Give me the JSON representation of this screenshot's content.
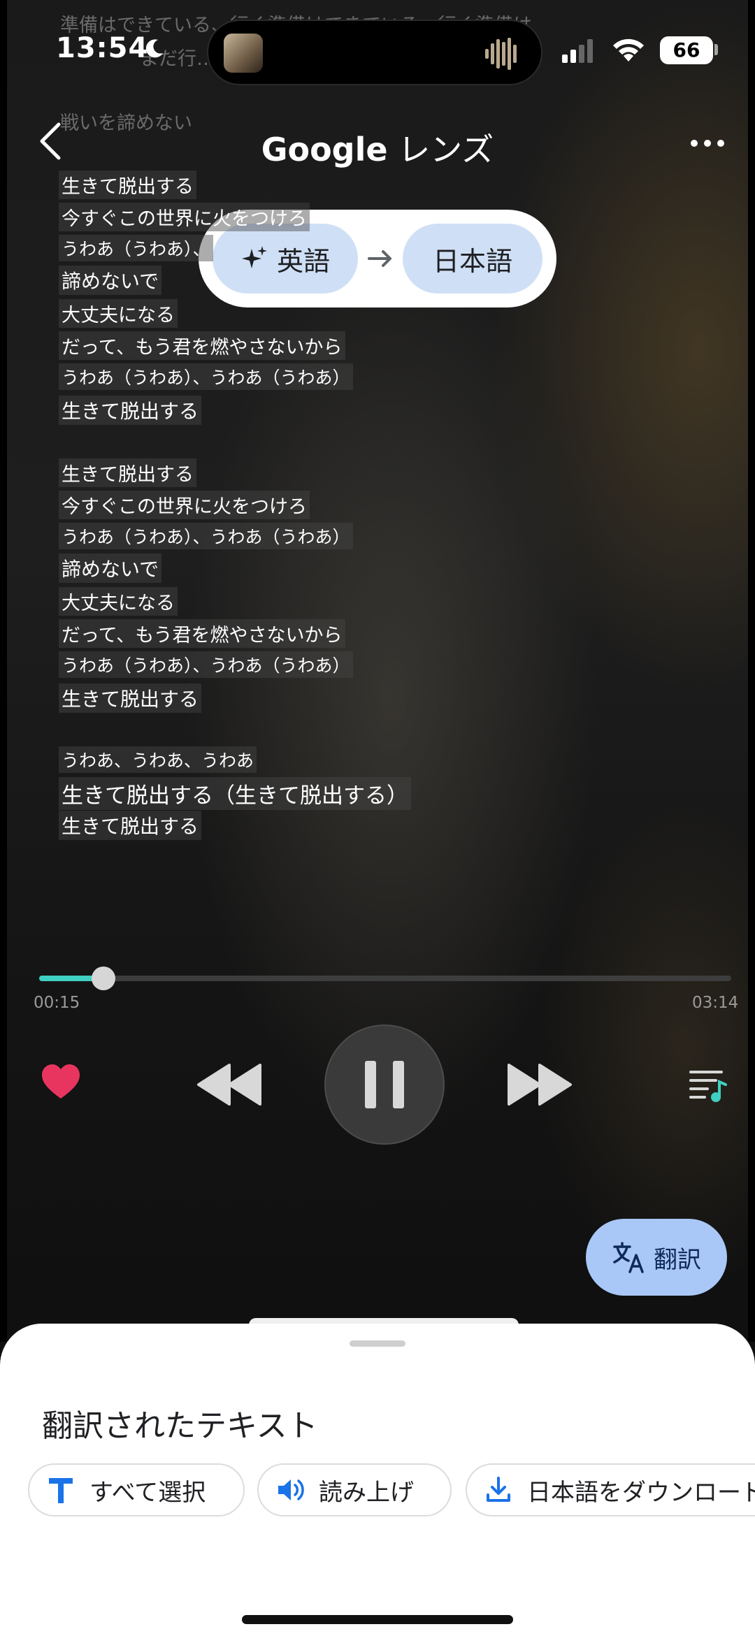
{
  "status_bar": {
    "time": "13:54",
    "battery": "66"
  },
  "faded_lyrics": [
    "準備はできている、行く準備はできている、行く準備は",
    "まだ行…",
    "戦いを諦めない"
  ],
  "header": {
    "title_brand": "Google",
    "title_suffix": "レンズ"
  },
  "translation": {
    "source_lang": "英語",
    "target_lang": "日本語"
  },
  "lyrics": [
    "生きて脱出する",
    "今すぐこの世界に火をつけろ",
    "うわあ（うわあ）、",
    "諦めないで",
    "大丈夫になる",
    "だって、もう君を燃やさないから",
    "うわあ（うわあ）、うわあ（うわあ）",
    "生きて脱出する",
    "生きて脱出する",
    "今すぐこの世界に火をつけろ",
    "うわあ（うわあ）、うわあ（うわあ）",
    "諦めないで",
    "大丈夫になる",
    "だって、もう君を燃やさないから",
    "うわあ（うわあ）、うわあ（うわあ）",
    "生きて脱出する",
    "うわあ、うわあ、うわあ",
    "生きて脱出する（生きて脱出する）",
    "生きて脱出する"
  ],
  "player": {
    "elapsed": "00:15",
    "duration": "03:14",
    "progress": 0.093,
    "accent_color": "#3fd0c2",
    "heart_color": "#e8355f"
  },
  "translate_button": {
    "label": "翻訳"
  },
  "sheet": {
    "title": "翻訳されたテキスト",
    "actions": [
      "すべて選択",
      "読み上げ",
      "日本語をダウンロード"
    ]
  }
}
